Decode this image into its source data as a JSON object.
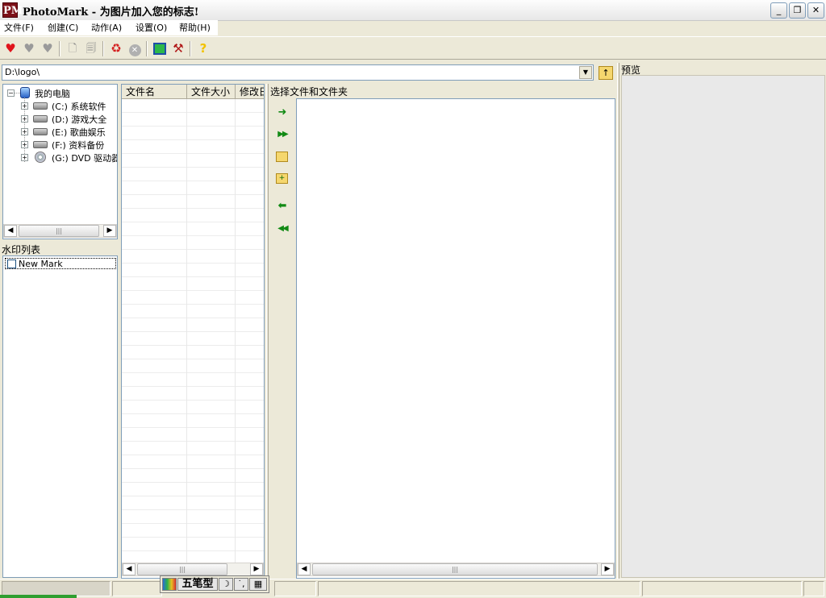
{
  "window": {
    "icon_text": "PM",
    "title": "PhotoMark - 为图片加入您的标志!",
    "controls": {
      "minimize": "_",
      "restore": "❐",
      "close": "✕"
    }
  },
  "menu": [
    "文件(F)",
    "创建(C)",
    "动作(A)",
    "设置(O)",
    "帮助(H)"
  ],
  "toolbar": {
    "icons": [
      "heart-icon",
      "heart-gray-icon",
      "heart-broken-icon",
      "document-add-icon",
      "document-copy-icon",
      "recycle-icon",
      "cancel-icon",
      "window-icon",
      "tools-icon",
      "help-icon"
    ],
    "colors": {
      "heart": "#e0141c",
      "recycle": "#d42020",
      "help": "#f2c200"
    }
  },
  "path": {
    "value": "D:\\logo\\"
  },
  "preview": {
    "label": "预览"
  },
  "tree": {
    "root": "我的电脑",
    "drives": [
      {
        "letter": "(C:)",
        "name": "系统软件",
        "type": "hdd"
      },
      {
        "letter": "(D:)",
        "name": "游戏大全",
        "type": "hdd"
      },
      {
        "letter": "(E:)",
        "name": "歌曲娱乐",
        "type": "hdd"
      },
      {
        "letter": "(F:)",
        "name": "资料备份",
        "type": "hdd"
      },
      {
        "letter": "(G:)",
        "name": "DVD 驱动器",
        "type": "cd"
      }
    ]
  },
  "watermarks": {
    "title": "水印列表",
    "items": [
      {
        "label": "New Mark",
        "checked": false
      }
    ]
  },
  "file_list": {
    "columns": [
      "文件名",
      "文件大小",
      "修改日期"
    ]
  },
  "selection": {
    "label": "选择文件和文件夹"
  },
  "move_buttons": [
    "add-arrow-icon",
    "add-all-arrow-icon",
    "add-folder-icon",
    "add-subfolders-icon",
    "remove-arrow-icon",
    "remove-all-arrow-icon"
  ],
  "ime": {
    "name": "五笔型"
  },
  "accent": "#118a14"
}
